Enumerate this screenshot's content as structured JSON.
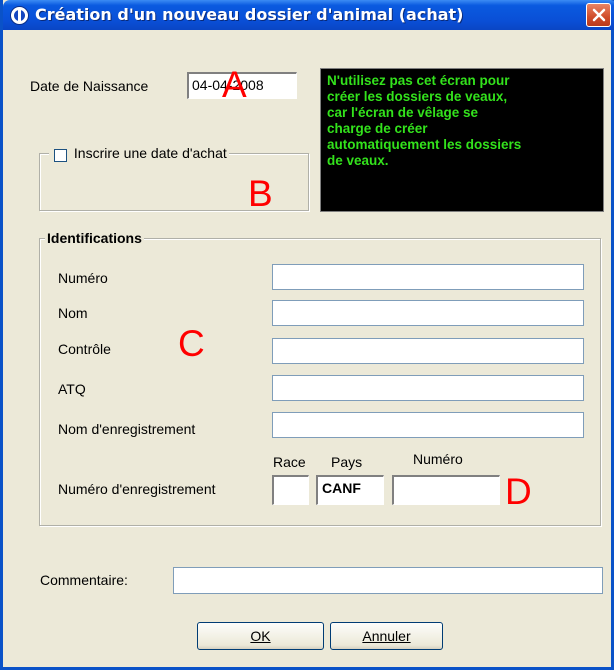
{
  "window": {
    "title": "Création d'un nouveau dossier d'animal  (achat)"
  },
  "birth": {
    "label": "Date de Naissance",
    "value": "04-04-2008"
  },
  "message": "N'utilisez pas cet écran pour\ncréer les dossiers de veaux,\ncar l'écran de vêlage se\ncharge de créer\nautomatiquement les dossiers\nde veaux.",
  "purchase": {
    "checkbox_label": "Inscrire une date d'achat",
    "checked": false
  },
  "identifications": {
    "title": "Identifications",
    "fields": [
      {
        "label": "Numéro",
        "value": ""
      },
      {
        "label": "Nom",
        "value": ""
      },
      {
        "label": "Contrôle",
        "value": ""
      },
      {
        "label": "ATQ",
        "value": ""
      },
      {
        "label": "Nom d'enregistrement",
        "value": ""
      }
    ],
    "registration": {
      "label": "Numéro d'enregistrement",
      "race_header": "Race",
      "pays_header": "Pays",
      "numero_header": "Numéro",
      "race_value": "",
      "pays_value": "CANF",
      "numero_value": ""
    }
  },
  "comment": {
    "label": "Commentaire:",
    "value": ""
  },
  "buttons": {
    "ok": "OK",
    "cancel": "Annuler"
  },
  "annotations": {
    "a": "A",
    "b": "B",
    "c": "C",
    "d": "D"
  },
  "colors": {
    "title_bar": "#0a4fd6",
    "message_text": "#33e21c",
    "message_bg": "#000000",
    "annotation": "#ff0000",
    "close_button": "#d04c2a"
  }
}
